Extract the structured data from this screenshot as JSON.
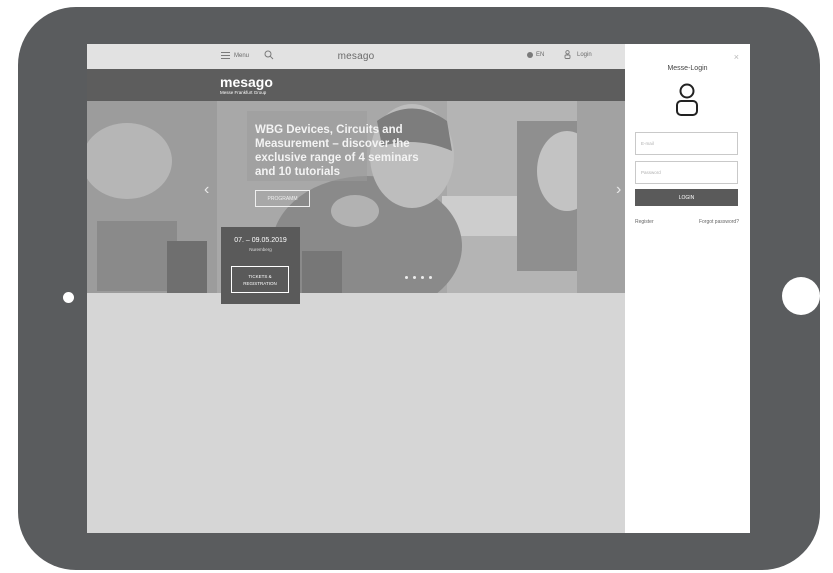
{
  "nav": {
    "menu_label": "Menu",
    "logo": "mesago",
    "language": "EN",
    "login_label": "Login"
  },
  "brand": {
    "logo": "mesago",
    "subtitle": "Messe Frankfurt Group"
  },
  "hero": {
    "headline": "WBG Devices, Circuits and Measurement – discover the exclusive range of 4 seminars and 10 tutorials",
    "button_label": "PROGRAMM",
    "prev_arrow": "‹",
    "next_arrow": "›",
    "slide_count": 4
  },
  "event": {
    "date": "07. – 09.05.2019",
    "city": "Nuremberg",
    "tickets_label": "TICKETS & REGISTRATION"
  },
  "login_panel": {
    "close": "×",
    "title": "Messe-Login",
    "email_placeholder": "E-mail",
    "password_placeholder": "Password",
    "login_button": "LOGIN",
    "register_link": "Register",
    "forgot_link": "Forgot password?"
  },
  "icons": [
    "hamburger-icon",
    "search-icon",
    "globe-icon",
    "user-icon",
    "close-icon",
    "chevron-left-icon",
    "chevron-right-icon"
  ],
  "colors": {
    "device_frame": "#5a5c5e",
    "brand_bar": "#5d5d5d",
    "panel_background": "#ffffff",
    "login_button": "#5a5a5a"
  }
}
